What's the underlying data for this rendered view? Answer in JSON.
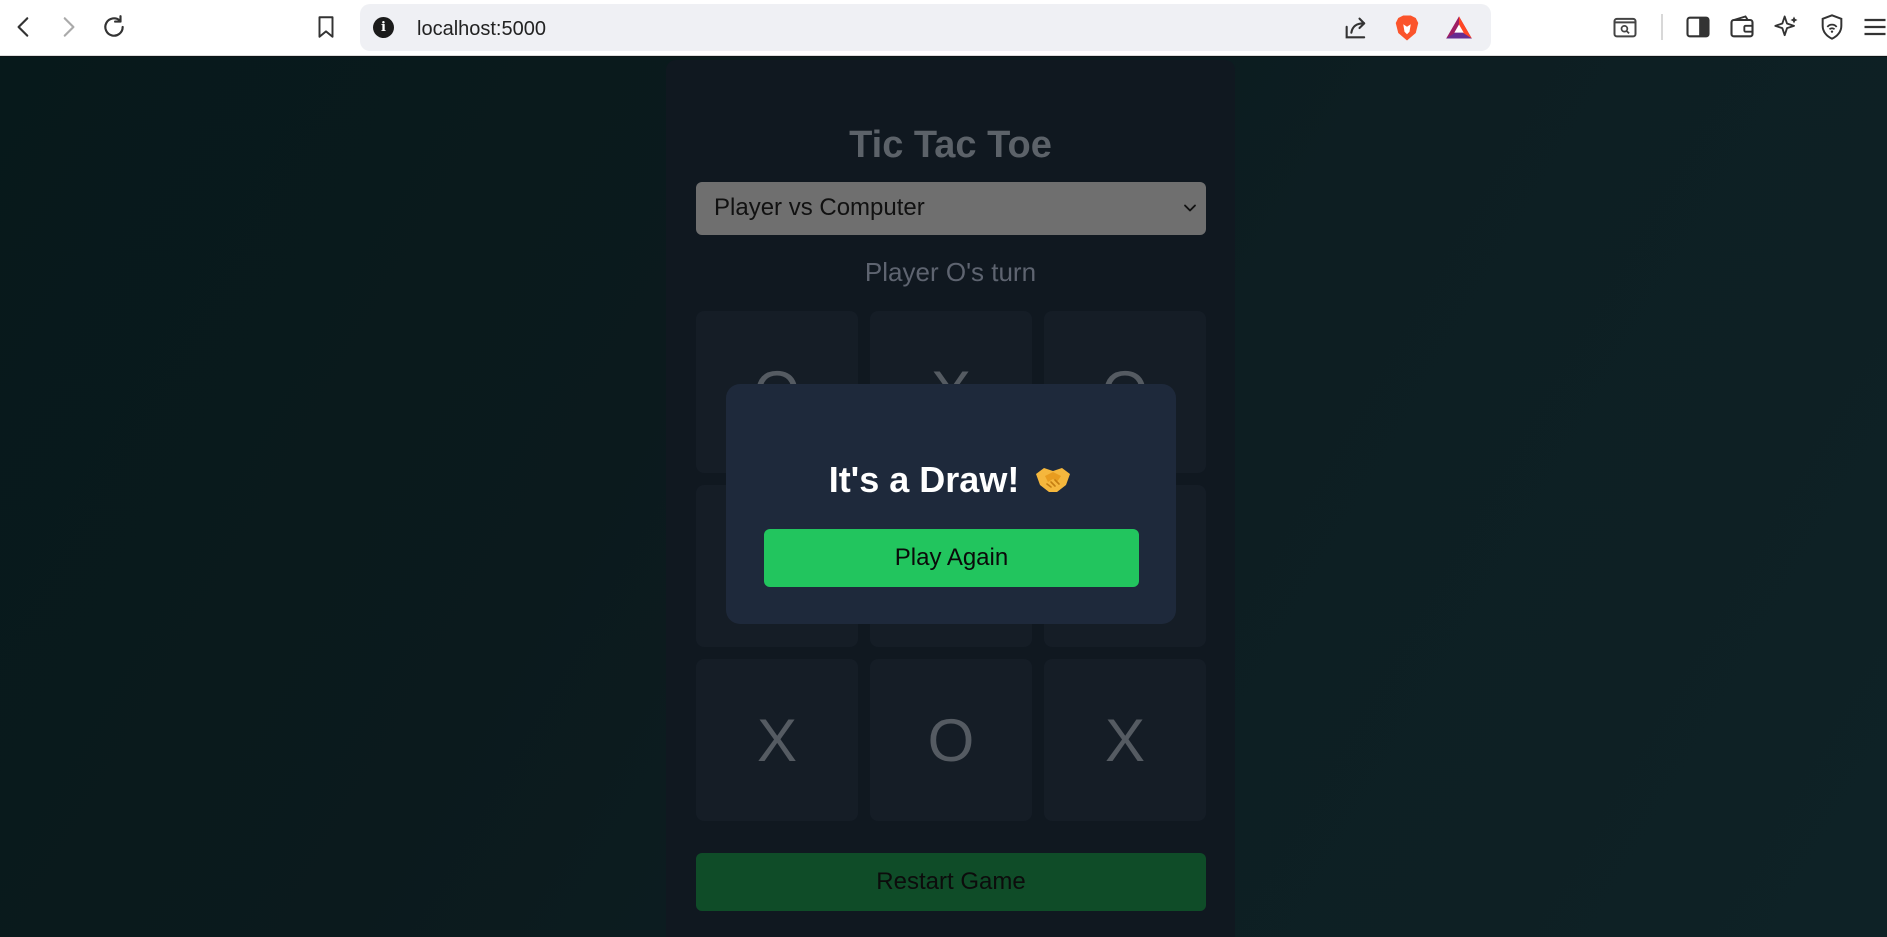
{
  "browser": {
    "url": "localhost:5000",
    "icons": {
      "back": "back-icon",
      "forward": "forward-icon",
      "reload": "reload-icon",
      "bookmark": "bookmark-icon",
      "site_info": "info-icon",
      "share": "share-icon",
      "brave_shields": "brave-lion-icon",
      "rewards": "bat-triangle-icon",
      "search_tabs": "search-tabs-icon",
      "sidebar": "sidebar-icon",
      "wallet": "wallet-icon",
      "leo": "sparkle-icon",
      "vpn": "vpn-shield-icon"
    }
  },
  "game": {
    "title": "Tic Tac Toe",
    "mode_selected": "Player vs Computer",
    "status": "Player O's turn",
    "board": [
      "O",
      "X",
      "O",
      "",
      "",
      "",
      "X",
      "O",
      "X"
    ],
    "restart_label": "Restart Game"
  },
  "modal": {
    "message": "It's a Draw!",
    "emoji": "handshake-icon",
    "play_again_label": "Play Again"
  },
  "colors": {
    "accent_green": "#22c55e",
    "restart_green": "#0f4c28",
    "modal_bg": "#1e293b"
  }
}
